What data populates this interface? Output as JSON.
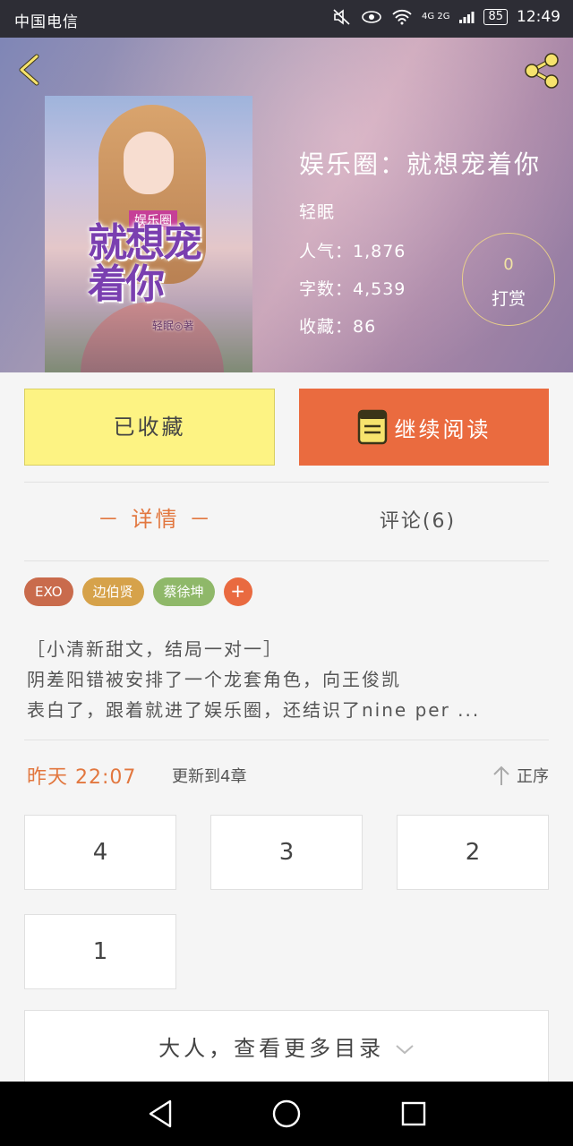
{
  "status_bar": {
    "carrier": "中国电信",
    "network": "4G 2G",
    "battery": "85",
    "time": "12:49"
  },
  "book": {
    "title": "娱乐圈：就想宠着你",
    "author": "轻眠",
    "popularity": "人气：1,876",
    "word_count": "字数：4,539",
    "favorites": "收藏：86",
    "cover": {
      "tag": "娱乐圈",
      "title": "就想宠着你",
      "author": "轻眠◎著"
    }
  },
  "reward": {
    "count": "0",
    "label": "打赏"
  },
  "actions": {
    "favorited_label": "已收藏",
    "continue_label": "继续阅读"
  },
  "tabs": {
    "detail": "－ 详情 －",
    "comments": "评论(6)"
  },
  "tags": [
    {
      "label": "EXO",
      "color": "#c96b4c"
    },
    {
      "label": "边伯贤",
      "color": "#d6a24a"
    },
    {
      "label": "蔡徐坤",
      "color": "#8fb869"
    }
  ],
  "tag_add": "+",
  "description": {
    "line1": "［小清新甜文，结局一对一］",
    "line2": "阴差阳错被安排了一个龙套角色，向王俊凯",
    "line3": "表白了，跟着就进了娱乐圈，还结识了nine  per ..."
  },
  "update": {
    "time": "昨天  22:07",
    "info": "更新到4章",
    "sort_label": "正序"
  },
  "chapters": [
    "4",
    "3",
    "2",
    "1"
  ],
  "more_catalog": "大人，查看更多目录",
  "colors": {
    "accent": "#ea6b3f",
    "favorite_bg": "#fdf383",
    "tab_active": "#e2773f"
  }
}
